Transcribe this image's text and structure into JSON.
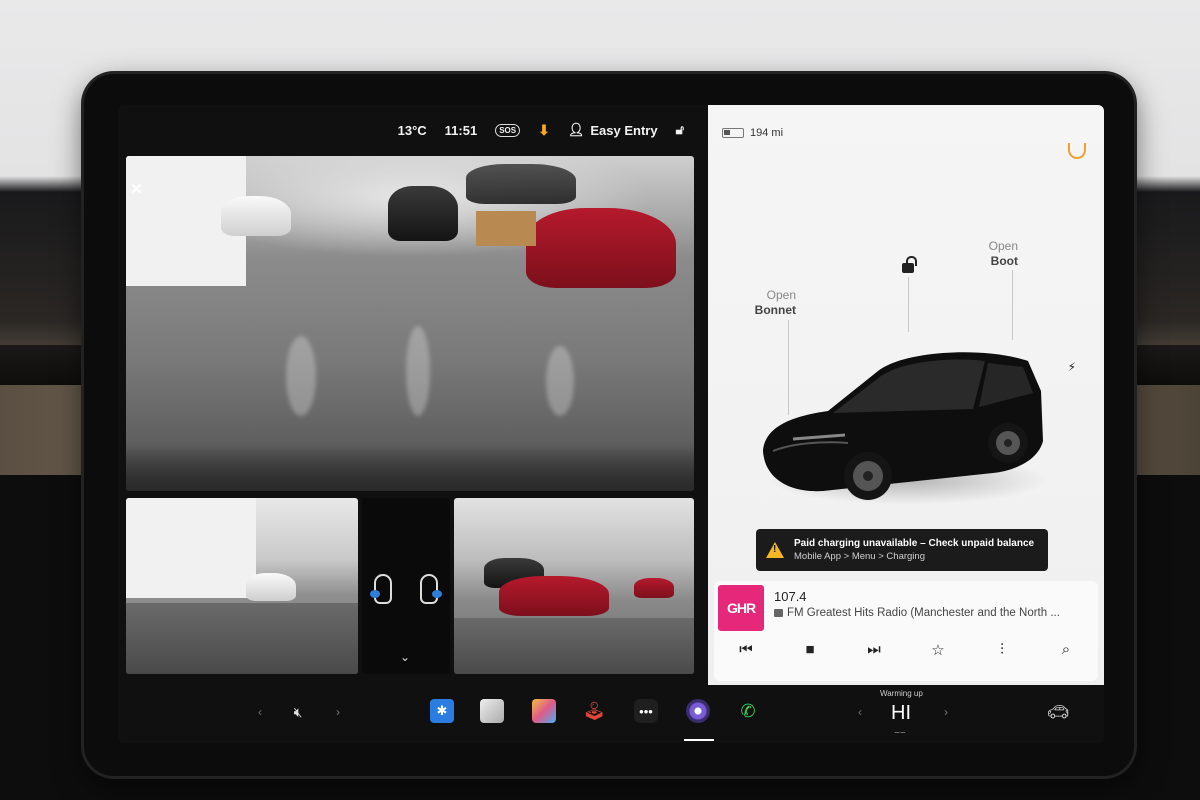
{
  "status_bar": {
    "temperature": "13°C",
    "time": "11:51",
    "sos_label": "SOS",
    "download_icon": "download-icon",
    "profile_label": "Easy Entry",
    "lock_icon": "unlock-icon"
  },
  "vehicle_panel": {
    "range": "194 mi",
    "bonnet": {
      "line1": "Open",
      "line2": "Bonnet"
    },
    "boot": {
      "line1": "Open",
      "line2": "Boot"
    },
    "tire_warning_icon": "tpms-icon",
    "charge_port_icon": "lightning-icon",
    "alert": {
      "title": "Paid charging unavailable – Check unpaid balance",
      "subtitle": "Mobile App > Menu > Charging"
    }
  },
  "media_player": {
    "logo_text": "GHR",
    "frequency": "107.4",
    "station_name": "FM Greatest Hits Radio (Manchester and the North ...",
    "controls": {
      "previous": "⏮",
      "stop": "■",
      "next": "⏭",
      "favorite": "☆",
      "equalizer": "⫶",
      "search": "⌕"
    }
  },
  "camera": {
    "close_label": "✕",
    "collapse_label": "⌄"
  },
  "dock": {
    "left_chevron": "‹",
    "mute_label": "🔇︎",
    "right_chevron": "›",
    "bluetooth_label": "✱",
    "dots_label": "•••",
    "phone_label": "✆",
    "climate_left": "‹",
    "climate_status": "Warming up",
    "climate_temp": "HI",
    "climate_right": "›",
    "seat_label": "⌣⌣",
    "car_label": "🚗︎"
  }
}
